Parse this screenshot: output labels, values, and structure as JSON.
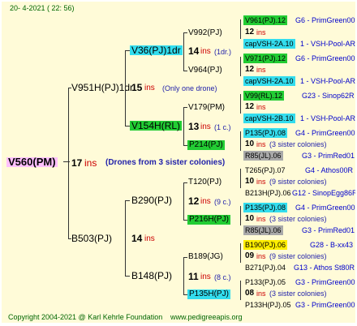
{
  "header": {
    "date": "20-   4-2021  ( 22:  56)"
  },
  "root": {
    "name": "V560(PM)",
    "ins": "17",
    "ins_label": "ins",
    "note": "(Drones from 3 sister colonies)"
  },
  "gen1": [
    {
      "name": "V951H(PJ)1dr",
      "ins": "15",
      "ins_label": "ins",
      "note": "(Only one drone)"
    },
    {
      "name": "B503(PJ)",
      "ins": "14",
      "ins_label": "ins",
      "note": ""
    }
  ],
  "gen2": [
    {
      "name": "V36(PJ)1dr",
      "ins": "14",
      "ins_label": "ins",
      "note": "(1dr.)"
    },
    {
      "name": "V154H(RL)",
      "ins": "13",
      "ins_label": "ins",
      "note": "(1 c.)"
    },
    {
      "name": "B290(PJ)",
      "ins": "12",
      "ins_label": "ins",
      "note": "(9 c.)"
    },
    {
      "name": "B148(PJ)",
      "ins": "11",
      "ins_label": "ins",
      "note": "(8 c.)"
    }
  ],
  "gen3": [
    {
      "name": "V992(PJ)",
      "ins": "12",
      "ins_label": "ins",
      "note": ""
    },
    {
      "name": "V964(PJ)",
      "ins": "12",
      "ins_label": "ins",
      "note": ""
    },
    {
      "name": "V179(PM)",
      "ins": "12",
      "ins_label": "ins",
      "note": ""
    },
    {
      "name": "P214(PJ)",
      "ins": "10",
      "ins_label": "ins",
      "note": "(3 sister colonies)"
    },
    {
      "name": "T120(PJ)",
      "ins": "10",
      "ins_label": "ins",
      "note": "(9 sister colonies)"
    },
    {
      "name": "P216H(PJ)",
      "ins": "10",
      "ins_label": "ins",
      "note": "(3 sister colonies)"
    },
    {
      "name": "B189(JG)",
      "ins": "09",
      "ins_label": "ins",
      "note": "(9 sister colonies)"
    },
    {
      "name": "P135H(PJ)",
      "ins": "08",
      "ins_label": "ins",
      "note": "(3 sister colonies)"
    }
  ],
  "gen4": [
    {
      "name": "V961(PJ).12",
      "src": "G6 - PrimGreen00"
    },
    {
      "name": "capVSH-2A.10",
      "src": "1 - VSH-Pool-AR"
    },
    {
      "name": "V971(PJ).12",
      "src": "G6 - PrimGreen00"
    },
    {
      "name": "capVSH-2A.10",
      "src": "1 - VSH-Pool-AR"
    },
    {
      "name": "V99(RL).12",
      "src": "G23 - Sinop62R"
    },
    {
      "name": "capVSH-2B.10",
      "src": "1 - VSH-Pool-AR"
    },
    {
      "name": "P135(PJ).08",
      "src": "G4 - PrimGreen00"
    },
    {
      "name": "R85(JL).06",
      "src": "G3 - PrimRed01"
    },
    {
      "name": "T265(PJ).07",
      "src": "G4 - Athos00R"
    },
    {
      "name": "B213H(PJ).06",
      "src": "G12 - SinopEgg86R"
    },
    {
      "name": "P135(PJ).08",
      "src": "G4 - PrimGreen00"
    },
    {
      "name": "R85(JL).06",
      "src": "G3 - PrimRed01"
    },
    {
      "name": "B190(PJ).06",
      "src": "G28 - B-xx43"
    },
    {
      "name": "B271(PJ).04",
      "src": "G13 - Athos St80R"
    },
    {
      "name": "P133(PJ).05",
      "src": "G3 - PrimGreen00"
    },
    {
      "name": "P133H(PJ).05",
      "src": "G3 - PrimGreen00"
    }
  ],
  "footer": {
    "copyright": "Copyright 2004-2021 @ Karl Kehrle Foundation",
    "url": "www.pedigreeapis.org"
  }
}
